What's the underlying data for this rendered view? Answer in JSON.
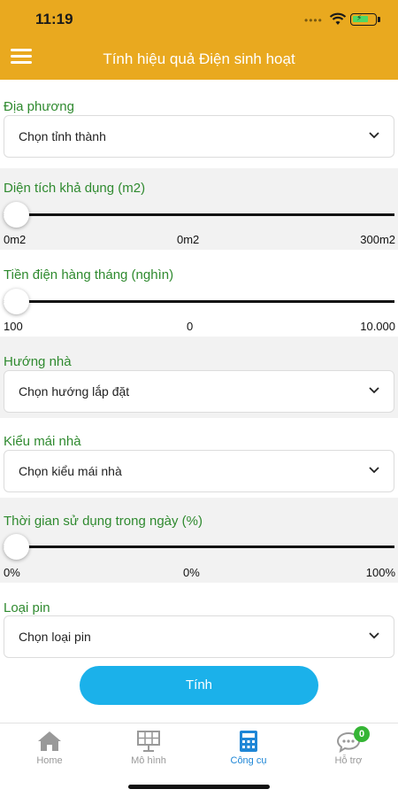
{
  "status": {
    "time": "11:19",
    "dots": "••••"
  },
  "header": {
    "title": "Tính hiệu quả Điện sinh hoạt",
    "color": "#e9a91f"
  },
  "location": {
    "label": "Địa phương",
    "value": "Chọn tỉnh thành"
  },
  "area": {
    "label": "Diện tích khả dụng (m2)",
    "min": "0m2",
    "current": "0m2",
    "max": "300m2",
    "level": 0
  },
  "bill": {
    "label": "Tiền điện hàng tháng (nghìn)",
    "min": "100",
    "current": "0",
    "max": "10.000",
    "level": 0
  },
  "direction": {
    "label": "Hướng nhà",
    "value": "Chọn hướng lắp đặt"
  },
  "roof": {
    "label": "Kiểu mái nhà",
    "value": "Chọn kiểu mái nhà"
  },
  "usage": {
    "label": "Thời gian sử dụng trong ngày (%)",
    "min": "0%",
    "current": "0%",
    "max": "100%",
    "level": 0
  },
  "battery": {
    "label": "Loại pin",
    "value": "Chọn loại pin"
  },
  "calculate": {
    "label": "Tính",
    "color": "#1bb1ea"
  },
  "tabs": [
    {
      "label": "Home",
      "icon": "home-icon",
      "active": false
    },
    {
      "label": "Mô hình",
      "icon": "solar-panel-icon",
      "active": false
    },
    {
      "label": "Công cụ",
      "icon": "calculator-icon",
      "active": true
    },
    {
      "label": "Hỗ trợ",
      "icon": "chat-icon",
      "active": false,
      "badge": "0"
    }
  ],
  "colors": {
    "label_green": "#2f8a2f",
    "active_blue": "#1e86d6",
    "inactive_grey": "#999999"
  }
}
